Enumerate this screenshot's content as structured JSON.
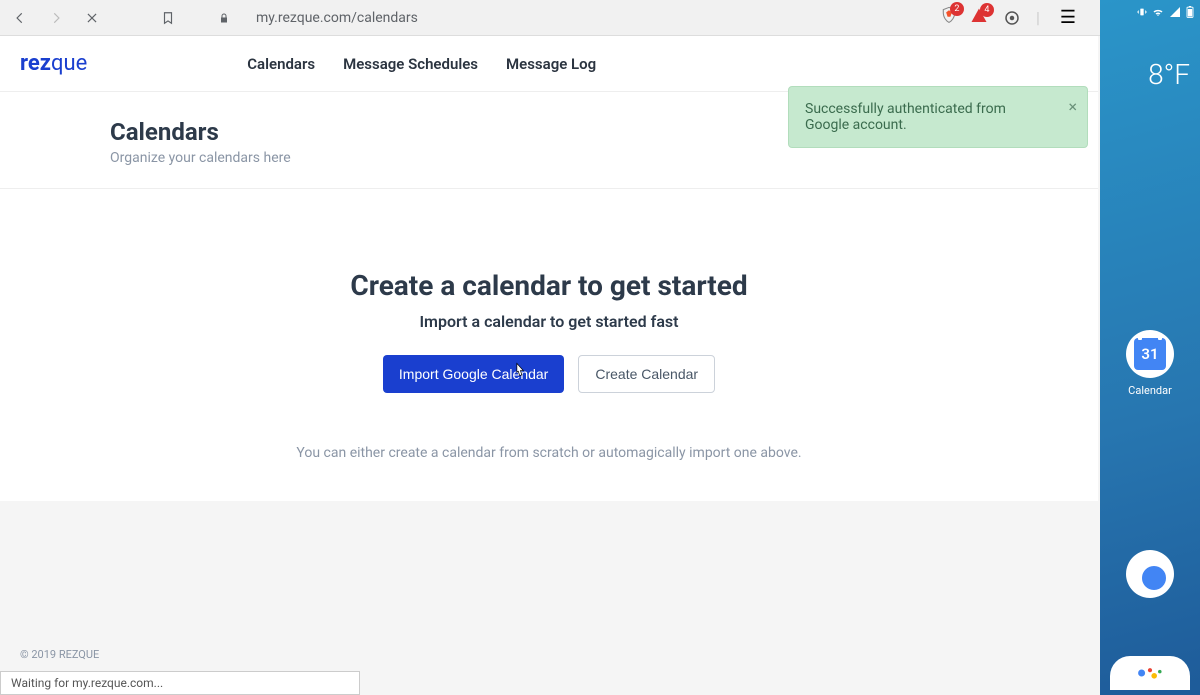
{
  "browser": {
    "url": "my.rezque.com/calendars",
    "ext_badge_1": "2",
    "ext_badge_2": "4"
  },
  "logo": {
    "bold": "rez",
    "thin": "que"
  },
  "nav": {
    "items": [
      {
        "label": "Calendars"
      },
      {
        "label": "Message Schedules"
      },
      {
        "label": "Message Log"
      }
    ]
  },
  "toast": {
    "message": "Successfully authenticated from Google account."
  },
  "page": {
    "title": "Calendars",
    "subtitle": "Organize your calendars here"
  },
  "hero": {
    "title": "Create a calendar to get started",
    "subtitle": "Import a calendar to get started fast",
    "primary_btn": "Import Google Calendar",
    "secondary_btn": "Create Calendar",
    "help": "You can either create a calendar from scratch or automagically import one above."
  },
  "footer": {
    "copyright": "© 2019 REZQUE"
  },
  "status": {
    "text": "Waiting for my.rezque.com..."
  },
  "phone": {
    "temp": "8°F",
    "calendar_label": "Calendar",
    "calendar_day": "31"
  }
}
